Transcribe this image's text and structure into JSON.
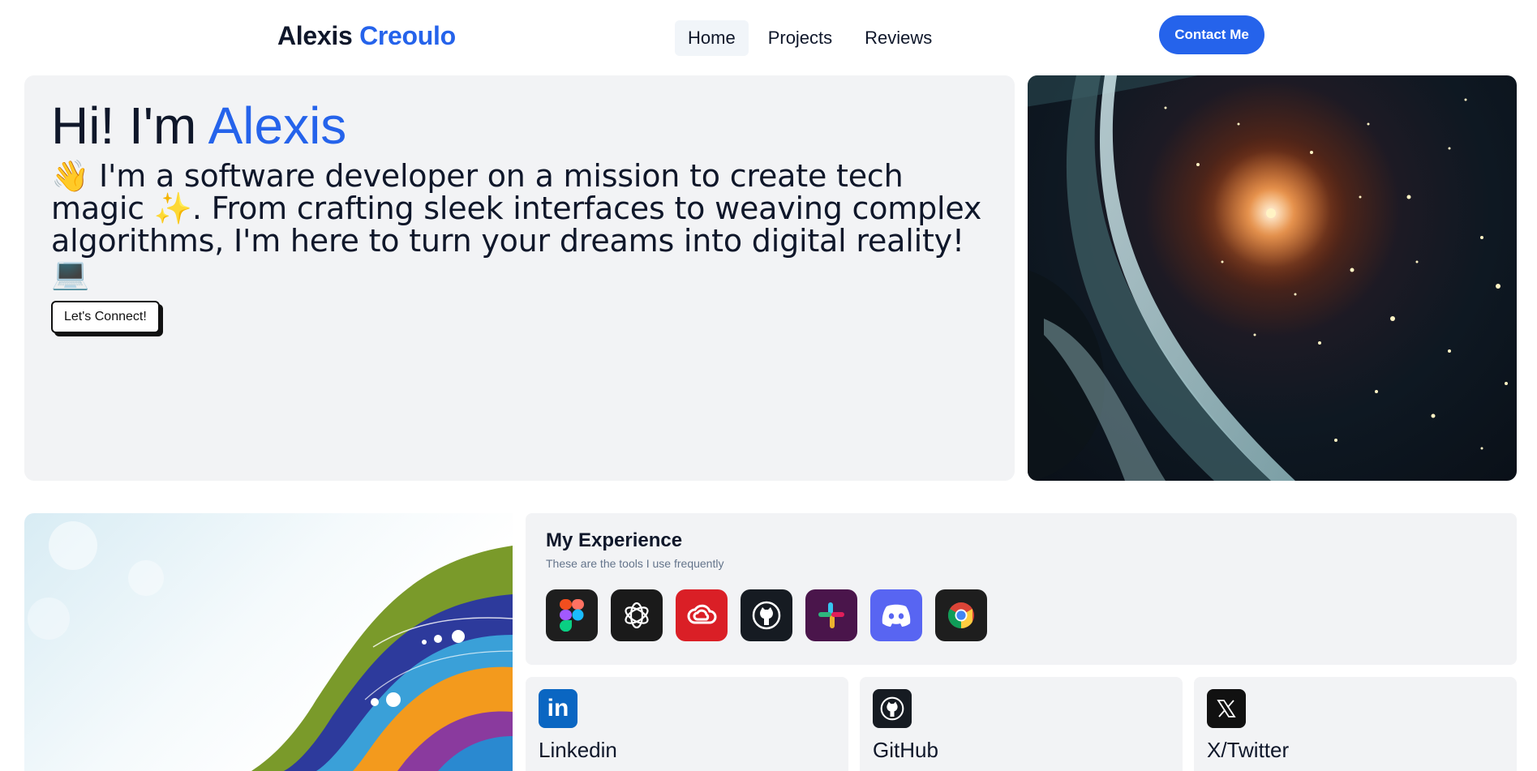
{
  "header": {
    "brand_first": "Alexis",
    "brand_last": "Creoulo",
    "nav": [
      {
        "label": "Home",
        "active": true
      },
      {
        "label": "Projects",
        "active": false
      },
      {
        "label": "Reviews",
        "active": false
      }
    ],
    "contact_label": "Contact Me"
  },
  "hero": {
    "greeting": "Hi! I'm",
    "name": "Alexis",
    "intro": "👋 I'm a software developer on a mission to create tech magic ✨. From crafting sleek interfaces to weaving complex algorithms, I'm here to turn your dreams into digital reality! 💻",
    "cta_label": "Let's Connect!"
  },
  "experience": {
    "title": "My Experience",
    "subtitle": "These are the tools I use frequently",
    "tools": [
      "figma-icon",
      "openai-icon",
      "creative-cloud-icon",
      "github-icon",
      "slack-icon",
      "discord-icon",
      "chrome-icon"
    ]
  },
  "socials": [
    {
      "label": "Linkedin",
      "icon": "linkedin-icon"
    },
    {
      "label": "GitHub",
      "icon": "github-icon"
    },
    {
      "label": "X/Twitter",
      "icon": "x-twitter-icon"
    }
  ],
  "colors": {
    "accent": "#2563eb",
    "card_bg": "#f2f3f5"
  }
}
